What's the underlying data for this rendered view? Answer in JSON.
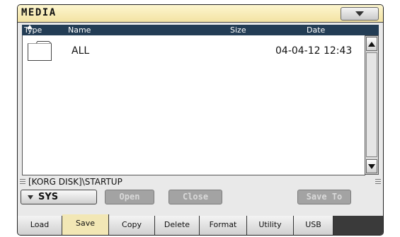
{
  "window": {
    "title": "MEDIA"
  },
  "columns": {
    "type": "Type",
    "name": "Name",
    "size": "Size",
    "date": "Date",
    "sort_column": "Type",
    "sort_direction": "ascending"
  },
  "files": [
    {
      "type_icon": "folder-icon",
      "name": "ALL",
      "size": "",
      "date": "04-04-12 12:43"
    }
  ],
  "path": "[KORG DISK]\\STARTUP",
  "device": {
    "label": "SYS"
  },
  "buttons": {
    "open": "Open",
    "close": "Close",
    "save_to": "Save To"
  },
  "tabs": [
    {
      "label": "Load",
      "active": false
    },
    {
      "label": "Save",
      "active": true
    },
    {
      "label": "Copy",
      "active": false
    },
    {
      "label": "Delete",
      "active": false
    },
    {
      "label": "Format",
      "active": false
    },
    {
      "label": "Utility",
      "active": false
    },
    {
      "label": "USB",
      "active": false
    }
  ],
  "colors": {
    "title_bar": "#f3e3a3",
    "header_bar": "#233d55",
    "active_tab": "#f2e7b5",
    "disabled_button": "#a3a3a3"
  }
}
